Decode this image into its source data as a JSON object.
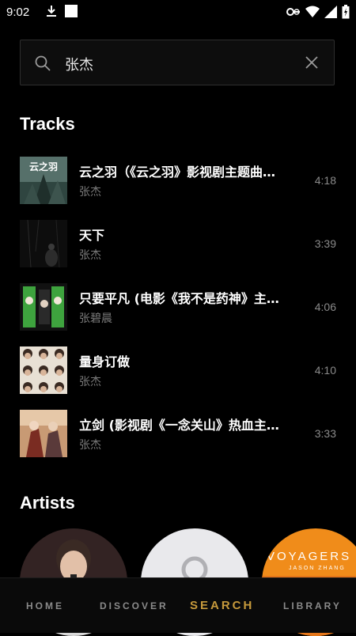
{
  "status_bar": {
    "time": "9:02"
  },
  "search": {
    "value": "张杰",
    "placeholder": ""
  },
  "sections": {
    "tracks": "Tracks",
    "artists": "Artists"
  },
  "tracks": [
    {
      "title": "云之羽（《云之羽》影视剧主题曲…",
      "artist": "张杰",
      "duration": "4:18"
    },
    {
      "title": "天下",
      "artist": "张杰",
      "duration": "3:39"
    },
    {
      "title": "只要平凡 (电影《我不是药神》主…",
      "artist": "张碧晨",
      "duration": "4:06"
    },
    {
      "title": "量身订做",
      "artist": "张杰",
      "duration": "4:10"
    },
    {
      "title": "立剑 (影视剧《一念关山》热血主…",
      "artist": "张杰",
      "duration": "3:33"
    }
  ],
  "artists": [
    {
      "image": "artist-photo-1"
    },
    {
      "image": "artist-placeholder"
    },
    {
      "image": "album-voyagers",
      "text": "VOYAGERS",
      "subtext": "JASON ZHANG"
    }
  ],
  "art_text": {
    "track1": "云之羽"
  },
  "nav": {
    "home": "HOME",
    "discover": "DISCOVER",
    "search": "SEARCH",
    "library": "LIBRARY"
  },
  "colors": {
    "background": "#000000",
    "accent": "#c79a3c",
    "muted": "#7a7a7a"
  }
}
